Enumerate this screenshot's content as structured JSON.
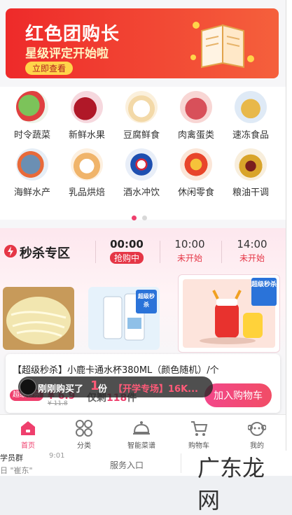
{
  "banner": {
    "title": "红色团购长",
    "subtitle": "星级评定开始啦",
    "button": "立即查看"
  },
  "categories": [
    {
      "label": "时令蔬菜",
      "icon": "vegetable-icon",
      "color": "#5aa64a"
    },
    {
      "label": "新鲜水果",
      "icon": "fruit-icon",
      "color": "#c92a3a"
    },
    {
      "label": "豆腐鲜食",
      "icon": "tofu-icon",
      "color": "#f2e6c8"
    },
    {
      "label": "肉禽蛋类",
      "icon": "meat-icon",
      "color": "#d86a62"
    },
    {
      "label": "速冻食品",
      "icon": "frozen-food-icon",
      "color": "#e8b84a"
    },
    {
      "label": "海鲜水产",
      "icon": "seafood-icon",
      "color": "#6b8fb3"
    },
    {
      "label": "乳品烘焙",
      "icon": "dairy-icon",
      "color": "#f0c48a"
    },
    {
      "label": "酒水冲饮",
      "icon": "drink-icon",
      "color": "#2a5ab8"
    },
    {
      "label": "休闲零食",
      "icon": "snack-icon",
      "color": "#e84a2a"
    },
    {
      "label": "粮油干调",
      "icon": "oil-icon",
      "color": "#c9942a"
    }
  ],
  "flash_sale": {
    "title": "秒杀专区",
    "slots": [
      {
        "time": "00:00",
        "status": "抢购中",
        "active": true
      },
      {
        "time": "10:00",
        "status": "未开始",
        "active": false
      },
      {
        "time": "14:00",
        "status": "未开始",
        "active": false
      }
    ],
    "tag": "超级秒杀",
    "product_name": "【超级秒杀】小鹿卡通水杯380ML（颜色随机）/个",
    "badge": "超级秒杀",
    "price": "¥ 6.9",
    "old_price": "¥ 11.8",
    "stock_prefix": "仅剩",
    "stock_count": "118",
    "stock_suffix": "件",
    "cart_button": "加入购物车"
  },
  "toast": {
    "text_a": "刚刚购买了",
    "count": "1",
    "unit": "份",
    "detail": "【开学专场】16K..."
  },
  "tabs": [
    {
      "label": "首页",
      "active": true
    },
    {
      "label": "分类",
      "active": false
    },
    {
      "label": "智能菜谱",
      "active": false
    },
    {
      "label": "购物车",
      "active": false
    },
    {
      "label": "我的",
      "active": false
    }
  ],
  "below": {
    "group_name": "学员群",
    "group_msg": "日 \"崔东\"",
    "time": "9:01",
    "service": "服务入口",
    "watermark": "广东龙网"
  },
  "colors": {
    "accent": "#ef3f6d",
    "banner": "#ee2a2a",
    "flash_red": "#e53646"
  }
}
